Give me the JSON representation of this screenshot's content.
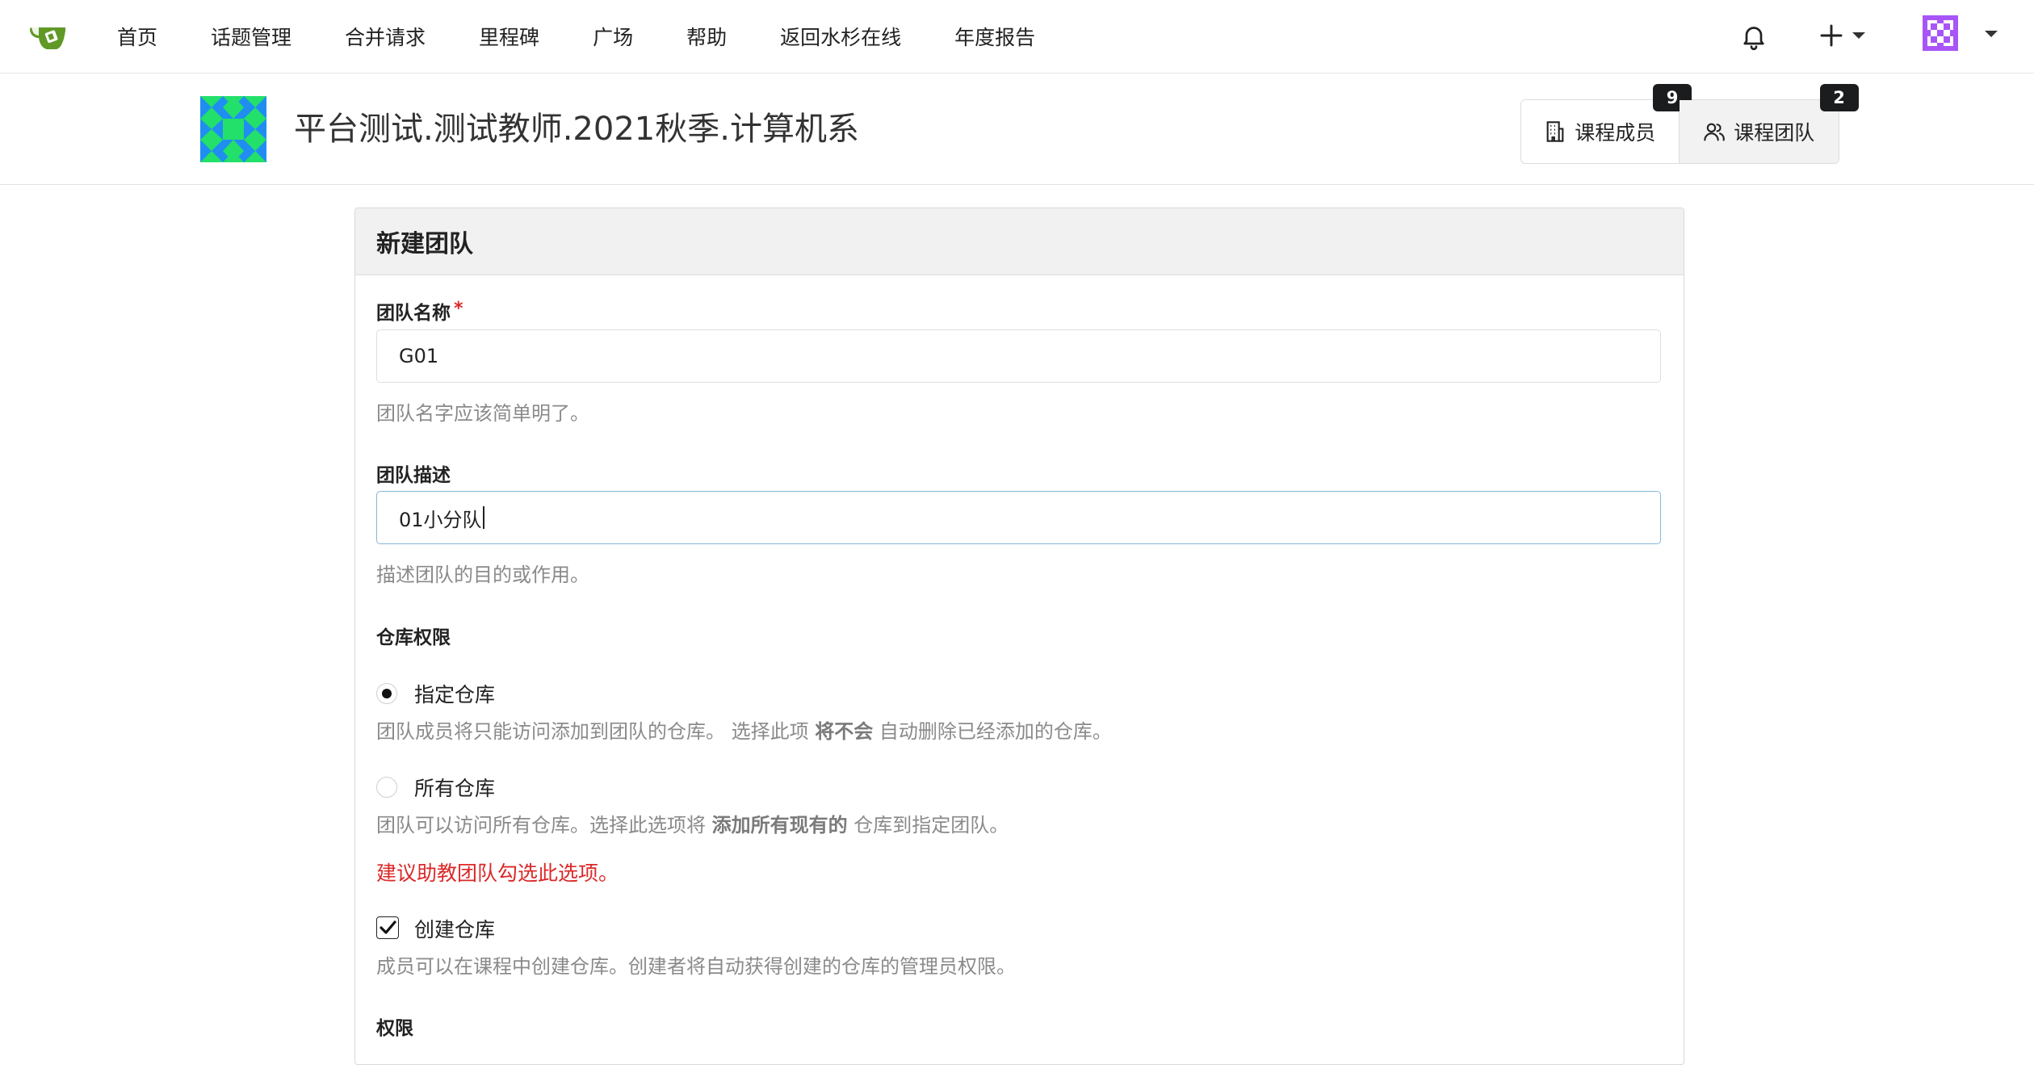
{
  "nav": {
    "items": [
      "首页",
      "话题管理",
      "合并请求",
      "里程碑",
      "广场",
      "帮助",
      "返回水杉在线",
      "年度报告"
    ],
    "icons": {
      "logo": "gitea-tea-logo",
      "notifications": "bell-icon",
      "create": "plus-icon",
      "user_menu": "caret-down-icon"
    }
  },
  "course": {
    "title": "平台测试.测试教师.2021秋季.计算机系",
    "tabs": [
      {
        "label": "课程成员",
        "badge": "9",
        "icon": "building-icon"
      },
      {
        "label": "课程团队",
        "badge": "2",
        "icon": "people-icon"
      }
    ]
  },
  "form": {
    "heading": "新建团队",
    "team_name": {
      "label": "团队名称",
      "required_mark": "*",
      "value": "G01",
      "help": "团队名字应该简单明了。"
    },
    "team_description": {
      "label": "团队描述",
      "value": "01小分队",
      "help": "描述团队的目的或作用。"
    },
    "repo_permission": {
      "label": "仓库权限",
      "specific": {
        "label": "指定仓库",
        "checked": true,
        "help_before": "团队成员将只能访问添加到团队的仓库。 选择此项",
        "help_bold": "将不会",
        "help_after": "自动删除已经添加的仓库。"
      },
      "all": {
        "label": "所有仓库",
        "checked": false,
        "help_before": "团队可以访问所有仓库。选择此选项将",
        "help_bold": "添加所有现有的",
        "help_after": "仓库到指定团队。"
      },
      "recommendation": "建议助教团队勾选此选项。"
    },
    "create_repo": {
      "label": "创建仓库",
      "checked": true,
      "help": "成员可以在课程中创建仓库。创建者将自动获得创建的仓库的管理员权限。"
    },
    "permission_label": "权限"
  },
  "colors": {
    "logo_green": "#609926",
    "avatar_green": "#22e06a",
    "avatar_blue": "#1f8ef0",
    "user_avatar_purple": "#a855f7",
    "warning_red": "#db2828",
    "badge_dark": "#1b1c1d"
  }
}
